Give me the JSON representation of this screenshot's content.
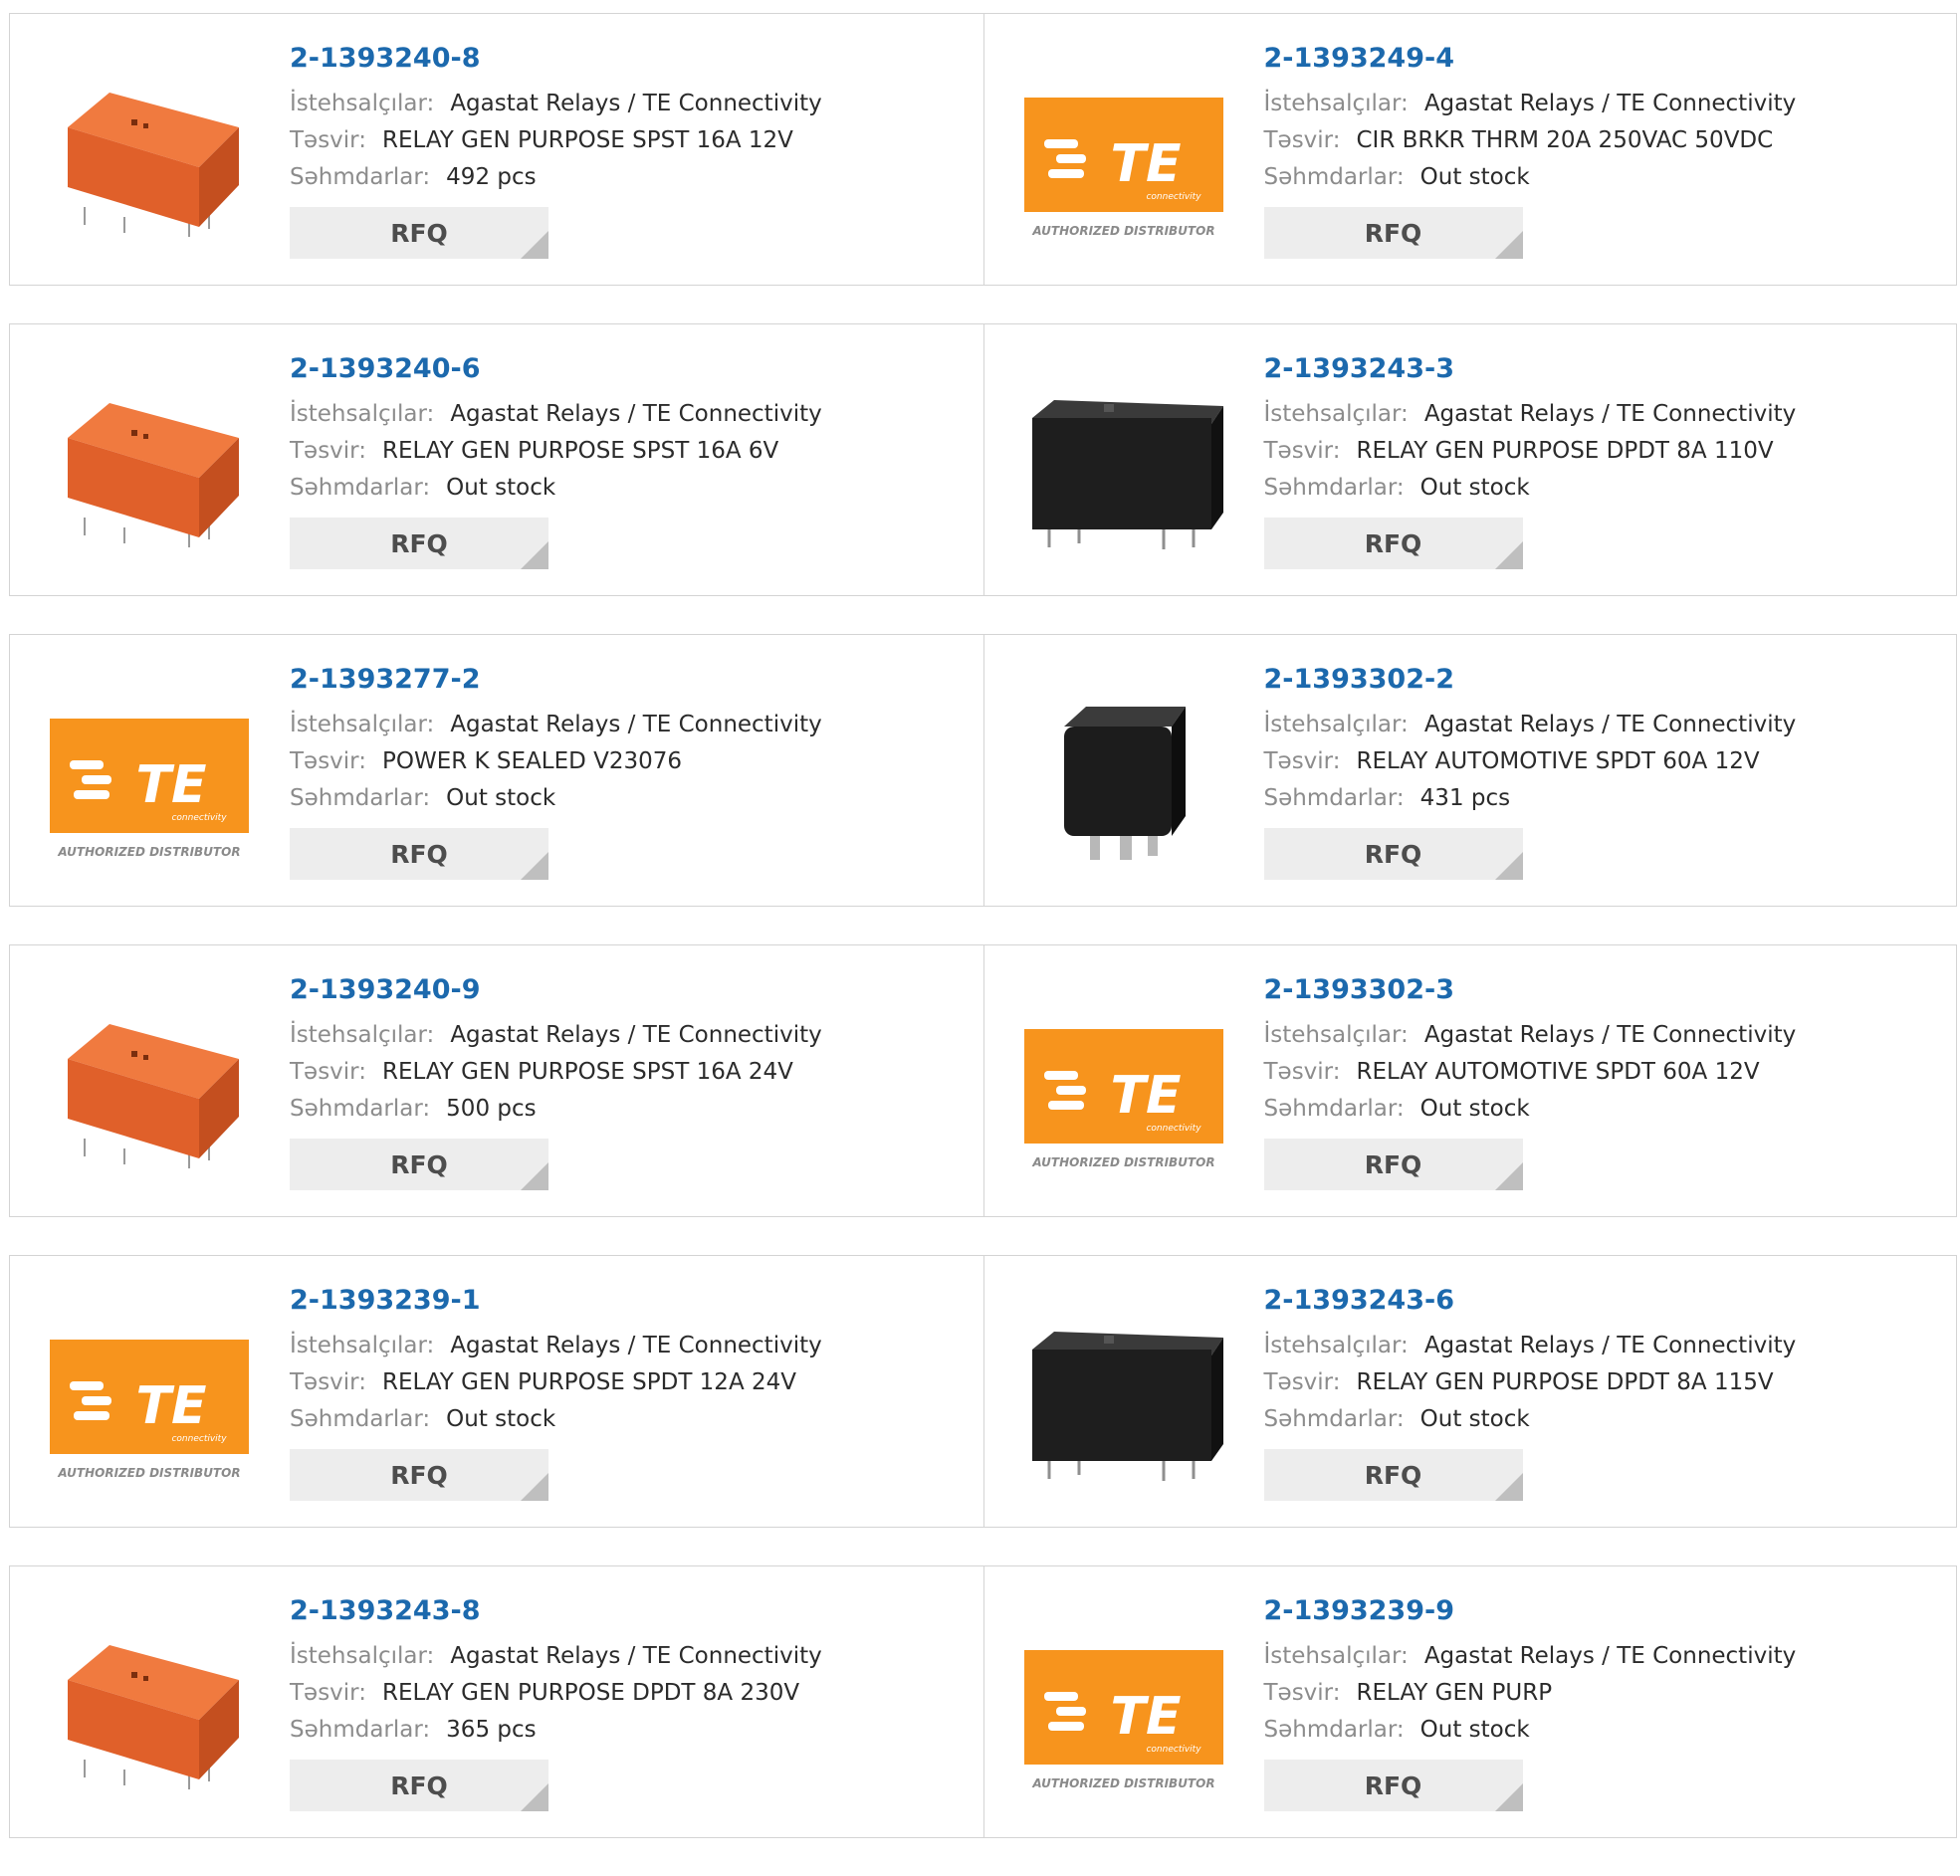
{
  "labels": {
    "manufacturer": "İstehsalçılar:",
    "description": "Təsvir:",
    "stock": "Səhmdarlar:",
    "rfq": "RFQ"
  },
  "logo": {
    "text": "TE",
    "subtext": "connectivity",
    "caption": "AUTHORIZED DISTRIBUTOR"
  },
  "colors": {
    "link": "#1c69ad",
    "te_orange": "#f7941d",
    "relay_orange": "#e0602a",
    "relay_black": "#1e1e1e"
  },
  "products": [
    {
      "part": "2-1393240-8",
      "manufacturer": "Agastat Relays / TE Connectivity",
      "description": "RELAY GEN PURPOSE SPST 16A 12V",
      "stock": "492 pcs",
      "image": "orange-relay-icon"
    },
    {
      "part": "2-1393249-4",
      "manufacturer": "Agastat Relays / TE Connectivity",
      "description": "CIR BRKR THRM 20A 250VAC 50VDC",
      "stock": "Out stock",
      "image": "te-logo-icon"
    },
    {
      "part": "2-1393240-6",
      "manufacturer": "Agastat Relays / TE Connectivity",
      "description": "RELAY GEN PURPOSE SPST 16A 6V",
      "stock": "Out stock",
      "image": "orange-relay-icon"
    },
    {
      "part": "2-1393243-3",
      "manufacturer": "Agastat Relays / TE Connectivity",
      "description": "RELAY GEN PURPOSE DPDT 8A 110V",
      "stock": "Out stock",
      "image": "black-relay-icon"
    },
    {
      "part": "2-1393277-2",
      "manufacturer": "Agastat Relays / TE Connectivity",
      "description": "POWER K SEALED V23076",
      "stock": "Out stock",
      "image": "te-logo-icon"
    },
    {
      "part": "2-1393302-2",
      "manufacturer": "Agastat Relays / TE Connectivity",
      "description": "RELAY AUTOMOTIVE SPDT 60A 12V",
      "stock": "431 pcs",
      "image": "automotive-relay-icon"
    },
    {
      "part": "2-1393240-9",
      "manufacturer": "Agastat Relays / TE Connectivity",
      "description": "RELAY GEN PURPOSE SPST 16A 24V",
      "stock": "500 pcs",
      "image": "orange-relay-icon"
    },
    {
      "part": "2-1393302-3",
      "manufacturer": "Agastat Relays / TE Connectivity",
      "description": "RELAY AUTOMOTIVE SPDT 60A 12V",
      "stock": "Out stock",
      "image": "te-logo-icon"
    },
    {
      "part": "2-1393239-1",
      "manufacturer": "Agastat Relays / TE Connectivity",
      "description": "RELAY GEN PURPOSE SPDT 12A 24V",
      "stock": "Out stock",
      "image": "te-logo-icon"
    },
    {
      "part": "2-1393243-6",
      "manufacturer": "Agastat Relays / TE Connectivity",
      "description": "RELAY GEN PURPOSE DPDT 8A 115V",
      "stock": "Out stock",
      "image": "black-relay-icon"
    },
    {
      "part": "2-1393243-8",
      "manufacturer": "Agastat Relays / TE Connectivity",
      "description": "RELAY GEN PURPOSE DPDT 8A 230V",
      "stock": "365 pcs",
      "image": "orange-relay-icon"
    },
    {
      "part": "2-1393239-9",
      "manufacturer": "Agastat Relays / TE Connectivity",
      "description": "RELAY GEN PURP",
      "stock": "Out stock",
      "image": "te-logo-icon"
    }
  ]
}
